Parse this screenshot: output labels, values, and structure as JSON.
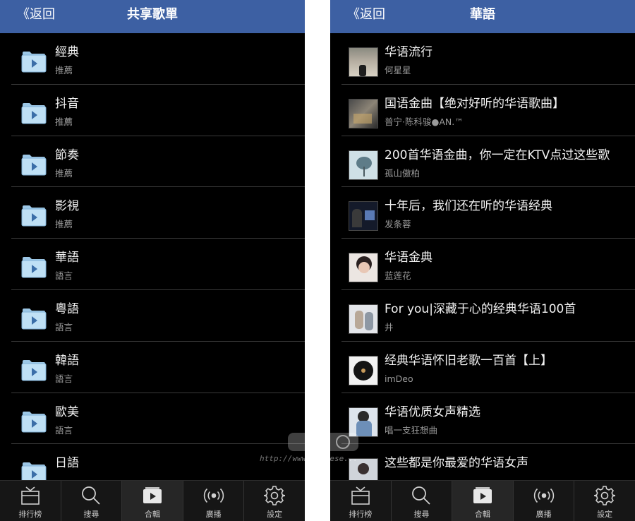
{
  "colors": {
    "header": "#3d60a3",
    "background": "#000000",
    "separator": "#3a3a3a",
    "folder": "#bfe0f5"
  },
  "left": {
    "back_label": "《返回",
    "title": "共享歌單",
    "items": [
      {
        "title": "經典",
        "sub": "推薦",
        "icon": "folder-play-icon"
      },
      {
        "title": "抖音",
        "sub": "推薦",
        "icon": "folder-play-icon"
      },
      {
        "title": "節奏",
        "sub": "推薦",
        "icon": "folder-play-icon"
      },
      {
        "title": "影視",
        "sub": "推薦",
        "icon": "folder-play-icon"
      },
      {
        "title": "華語",
        "sub": "語言",
        "icon": "folder-play-icon"
      },
      {
        "title": "粵語",
        "sub": "語言",
        "icon": "folder-play-icon"
      },
      {
        "title": "韓語",
        "sub": "語言",
        "icon": "folder-play-icon"
      },
      {
        "title": "歐美",
        "sub": "語言",
        "icon": "folder-play-icon"
      },
      {
        "title": "日語",
        "sub": "",
        "icon": "folder-play-icon"
      }
    ]
  },
  "right": {
    "back_label": "《返回",
    "title": "華語",
    "items": [
      {
        "title": "华语流行",
        "sub": "何星星"
      },
      {
        "title": "国语金曲【绝对好听的华语歌曲】",
        "sub": "普宁·陈科骏●AN.™"
      },
      {
        "title": "200首华语金曲，你一定在KTV点过这些歌",
        "sub": "孤山傲柏"
      },
      {
        "title": "十年后，我们还在听的华语经典",
        "sub": "发条蓉"
      },
      {
        "title": "华语金典",
        "sub": "蓝莲花"
      },
      {
        "title": "For you|深藏于心的经典华语100首",
        "sub": "井"
      },
      {
        "title": "经典华语怀旧老歌一百首【上】",
        "sub": "imDeo"
      },
      {
        "title": "华语优质女声精选",
        "sub": "唱一支狂想曲"
      },
      {
        "title": "这些都是你最爱的华语女声",
        "sub": ""
      }
    ]
  },
  "tabs": [
    {
      "label": "排行榜",
      "icon": "chart-tray-icon",
      "active": false
    },
    {
      "label": "搜尋",
      "icon": "search-icon",
      "active": false
    },
    {
      "label": "合輯",
      "icon": "album-play-icon",
      "active": true
    },
    {
      "label": "廣播",
      "icon": "broadcast-icon",
      "active": false
    },
    {
      "label": "設定",
      "icon": "gear-icon",
      "active": false
    }
  ],
  "watermark": {
    "text": "http://www.ricnese..."
  }
}
